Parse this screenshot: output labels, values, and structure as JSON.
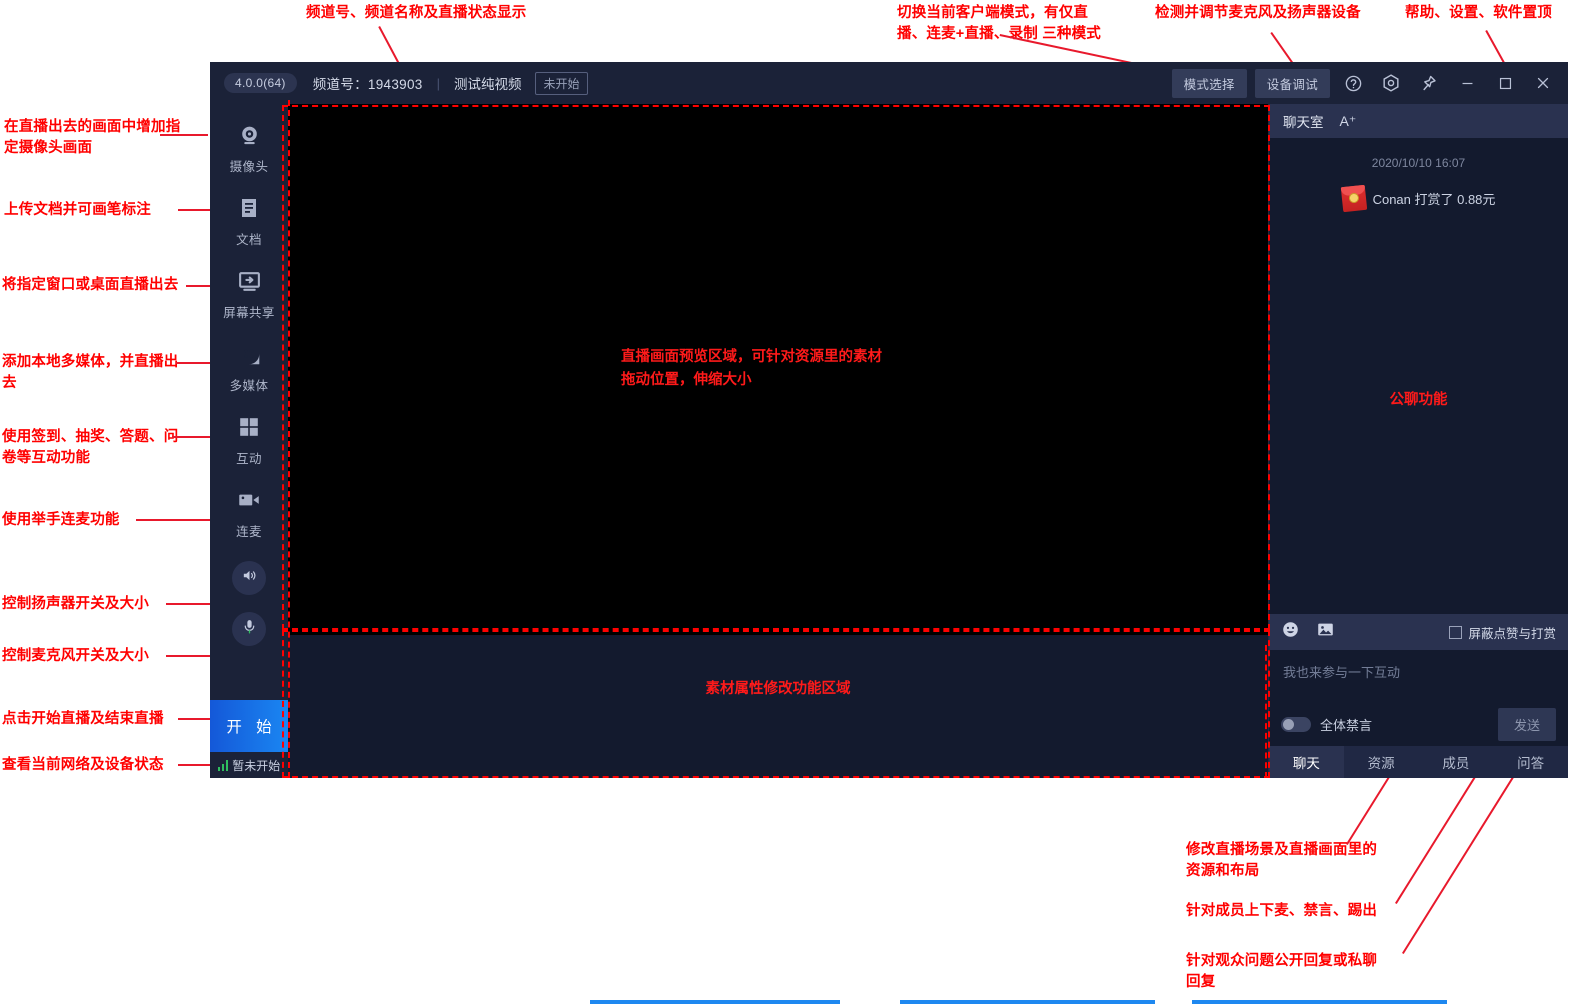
{
  "app": {
    "titlebar": {
      "version": "4.0.0(64)",
      "channel_label": "频道号：1943903",
      "separator": "|",
      "channel_name": "测试纯视频",
      "state": "未开始",
      "mode_button": "模式选择",
      "device_button": "设备调试",
      "icons": [
        "help-icon",
        "settings-icon",
        "pin-icon",
        "minimize-icon",
        "maximize-icon",
        "close-icon"
      ]
    },
    "sidebar": {
      "items": [
        {
          "icon": "camera-icon",
          "label": "摄像头"
        },
        {
          "icon": "document-icon",
          "label": "文档"
        },
        {
          "icon": "screen-share-icon",
          "label": "屏幕共享"
        },
        {
          "icon": "multimedia-icon",
          "label": "多媒体"
        },
        {
          "icon": "interaction-icon",
          "label": "互动"
        },
        {
          "icon": "linkmic-icon",
          "label": "连麦"
        }
      ],
      "round_buttons": [
        {
          "icon": "speaker-icon"
        },
        {
          "icon": "microphone-icon"
        }
      ],
      "start_button": "开 始",
      "status": "暂未开始"
    },
    "preview": {
      "note": "直播画面预览区域，可针对资源里的素材\n拖动位置，伸缩大小"
    },
    "property_zone": {
      "note": "素材属性修改功能区域"
    },
    "chat": {
      "header_title": "聊天室",
      "font_size_button": "A⁺",
      "message_time": "2020/10/10 16:07",
      "message_text": "Conan 打赏了 0.88元",
      "center_note": "公聊功能",
      "tools": {
        "emoji_icon": "emoji-icon",
        "image_icon": "image-icon",
        "checkbox_label": "屏蔽点赞与打赏"
      },
      "input_placeholder": "我也来参与一下互动",
      "mute_all_label": "全体禁言",
      "send_button": "发送",
      "tabs": [
        {
          "label": "聊天",
          "active": true
        },
        {
          "label": "资源",
          "active": false
        },
        {
          "label": "成员",
          "active": false
        },
        {
          "label": "问答",
          "active": false
        }
      ]
    }
  },
  "annotations": {
    "top": [
      "频道号、频道名称及直播状态显示",
      "切换当前客户端模式，有仅直\n播、连麦+直播、录制 三种模式",
      "检测并调节麦克风及扬声器设备",
      "帮助、设置、软件置顶"
    ],
    "left": [
      "在直播出去的画面中增加指\n定摄像头画面",
      "上传文档并可画笔标注",
      "将指定窗口或桌面直播出去",
      "添加本地多媒体，并直播出\n去",
      "使用签到、抽奖、答题、问\n卷等互动功能",
      "使用举手连麦功能",
      "控制扬声器开关及大小",
      "控制麦克风开关及大小",
      "点击开始直播及结束直播",
      "查看当前网络及设备状态"
    ],
    "bottom": [
      "修改直播场景及直播画面里的\n资源和布局",
      "针对成员上下麦、禁言、踢出",
      "针对观众问题公开回复或私聊\n回复"
    ]
  },
  "colors": {
    "annotation": "#ff0000",
    "window_bg": "#131a2e",
    "panel_bg": "#1b2238",
    "accent_blue": "#1a86f2",
    "status_green": "#2fbf5f"
  }
}
